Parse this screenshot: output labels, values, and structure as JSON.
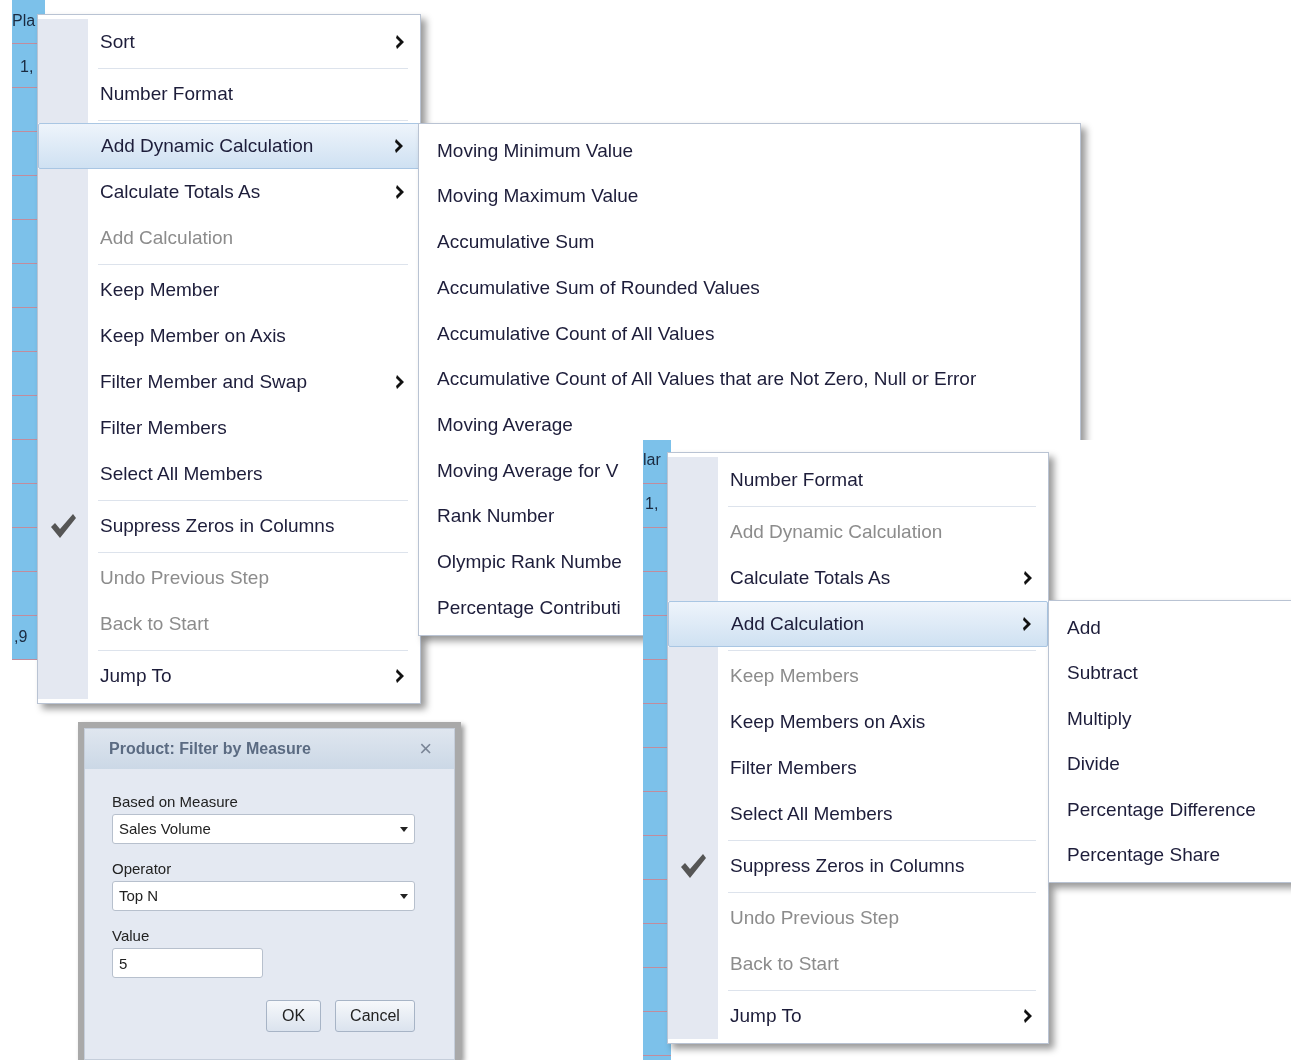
{
  "left_screenshot": {
    "grid_fragments": [
      {
        "text": "Pla"
      },
      {
        "text": "1,"
      },
      {
        "text": ",9"
      }
    ],
    "context_menu": {
      "items": [
        {
          "kind": "item",
          "label": "Sort",
          "submenu": true,
          "disabled": false,
          "checked": false,
          "selected": false
        },
        {
          "kind": "separator"
        },
        {
          "kind": "item",
          "label": "Number Format",
          "submenu": false,
          "disabled": false,
          "checked": false,
          "selected": false
        },
        {
          "kind": "separator"
        },
        {
          "kind": "item",
          "label": "Add Dynamic Calculation",
          "submenu": true,
          "disabled": false,
          "checked": false,
          "selected": true
        },
        {
          "kind": "item",
          "label": "Calculate Totals As",
          "submenu": true,
          "disabled": false,
          "checked": false,
          "selected": false
        },
        {
          "kind": "item",
          "label": "Add Calculation",
          "submenu": false,
          "disabled": true,
          "checked": false,
          "selected": false
        },
        {
          "kind": "separator"
        },
        {
          "kind": "item",
          "label": "Keep Member",
          "submenu": false,
          "disabled": false,
          "checked": false,
          "selected": false
        },
        {
          "kind": "item",
          "label": "Keep Member on Axis",
          "submenu": false,
          "disabled": false,
          "checked": false,
          "selected": false
        },
        {
          "kind": "item",
          "label": "Filter Member and Swap",
          "submenu": true,
          "disabled": false,
          "checked": false,
          "selected": false
        },
        {
          "kind": "item",
          "label": "Filter Members",
          "submenu": false,
          "disabled": false,
          "checked": false,
          "selected": false
        },
        {
          "kind": "item",
          "label": "Select All Members",
          "submenu": false,
          "disabled": false,
          "checked": false,
          "selected": false
        },
        {
          "kind": "separator"
        },
        {
          "kind": "item",
          "label": "Suppress Zeros in Columns",
          "submenu": false,
          "disabled": false,
          "checked": true,
          "selected": false
        },
        {
          "kind": "separator"
        },
        {
          "kind": "item",
          "label": "Undo Previous Step",
          "submenu": false,
          "disabled": true,
          "checked": false,
          "selected": false
        },
        {
          "kind": "item",
          "label": "Back to Start",
          "submenu": false,
          "disabled": true,
          "checked": false,
          "selected": false
        },
        {
          "kind": "separator"
        },
        {
          "kind": "item",
          "label": "Jump To",
          "submenu": true,
          "disabled": false,
          "checked": false,
          "selected": false
        }
      ]
    },
    "submenu": {
      "items": [
        {
          "label": "Moving Minimum Value"
        },
        {
          "label": "Moving Maximum Value"
        },
        {
          "label": "Accumulative Sum"
        },
        {
          "label": "Accumulative Sum of Rounded Values"
        },
        {
          "label": "Accumulative Count of All Values"
        },
        {
          "label": "Accumulative Count of All Values that are Not Zero, Null or Error"
        },
        {
          "label": "Moving Average"
        },
        {
          "label": "Moving Average for V"
        },
        {
          "label": "Rank Number"
        },
        {
          "label": "Olympic Rank Numbe"
        },
        {
          "label": "Percentage Contributi"
        }
      ]
    }
  },
  "filter_dialog": {
    "title": "Product: Filter by Measure",
    "close": "×",
    "fields": [
      {
        "kind": "select",
        "label": "Based on Measure",
        "value": "Sales Volume"
      },
      {
        "kind": "select",
        "label": "Operator",
        "value": "Top N"
      },
      {
        "kind": "input",
        "label": "Value",
        "value": "5"
      }
    ],
    "buttons": [
      "OK",
      "Cancel"
    ]
  },
  "right_screenshot": {
    "grid_fragments": [
      {
        "text": "lar"
      },
      {
        "text": "1,"
      }
    ],
    "context_menu": {
      "items": [
        {
          "kind": "item",
          "label": "Number Format",
          "submenu": false,
          "disabled": false,
          "checked": false,
          "selected": false
        },
        {
          "kind": "separator"
        },
        {
          "kind": "item",
          "label": "Add Dynamic Calculation",
          "submenu": false,
          "disabled": true,
          "checked": false,
          "selected": false
        },
        {
          "kind": "item",
          "label": "Calculate Totals As",
          "submenu": true,
          "disabled": false,
          "checked": false,
          "selected": false
        },
        {
          "kind": "item",
          "label": "Add Calculation",
          "submenu": true,
          "disabled": false,
          "checked": false,
          "selected": true
        },
        {
          "kind": "separator"
        },
        {
          "kind": "item",
          "label": "Keep Members",
          "submenu": false,
          "disabled": true,
          "checked": false,
          "selected": false
        },
        {
          "kind": "item",
          "label": "Keep Members on Axis",
          "submenu": false,
          "disabled": false,
          "checked": false,
          "selected": false
        },
        {
          "kind": "item",
          "label": "Filter Members",
          "submenu": false,
          "disabled": false,
          "checked": false,
          "selected": false
        },
        {
          "kind": "item",
          "label": "Select All Members",
          "submenu": false,
          "disabled": false,
          "checked": false,
          "selected": false
        },
        {
          "kind": "separator"
        },
        {
          "kind": "item",
          "label": "Suppress Zeros in Columns",
          "submenu": false,
          "disabled": false,
          "checked": true,
          "selected": false
        },
        {
          "kind": "separator"
        },
        {
          "kind": "item",
          "label": "Undo Previous Step",
          "submenu": false,
          "disabled": true,
          "checked": false,
          "selected": false
        },
        {
          "kind": "item",
          "label": "Back to Start",
          "submenu": false,
          "disabled": true,
          "checked": false,
          "selected": false
        },
        {
          "kind": "separator"
        },
        {
          "kind": "item",
          "label": "Jump To",
          "submenu": true,
          "disabled": false,
          "checked": false,
          "selected": false
        }
      ]
    },
    "submenu": {
      "items": [
        {
          "label": "Add"
        },
        {
          "label": "Subtract"
        },
        {
          "label": "Multiply"
        },
        {
          "label": "Divide"
        },
        {
          "label": "Percentage Difference"
        },
        {
          "label": "Percentage Share"
        }
      ]
    }
  }
}
